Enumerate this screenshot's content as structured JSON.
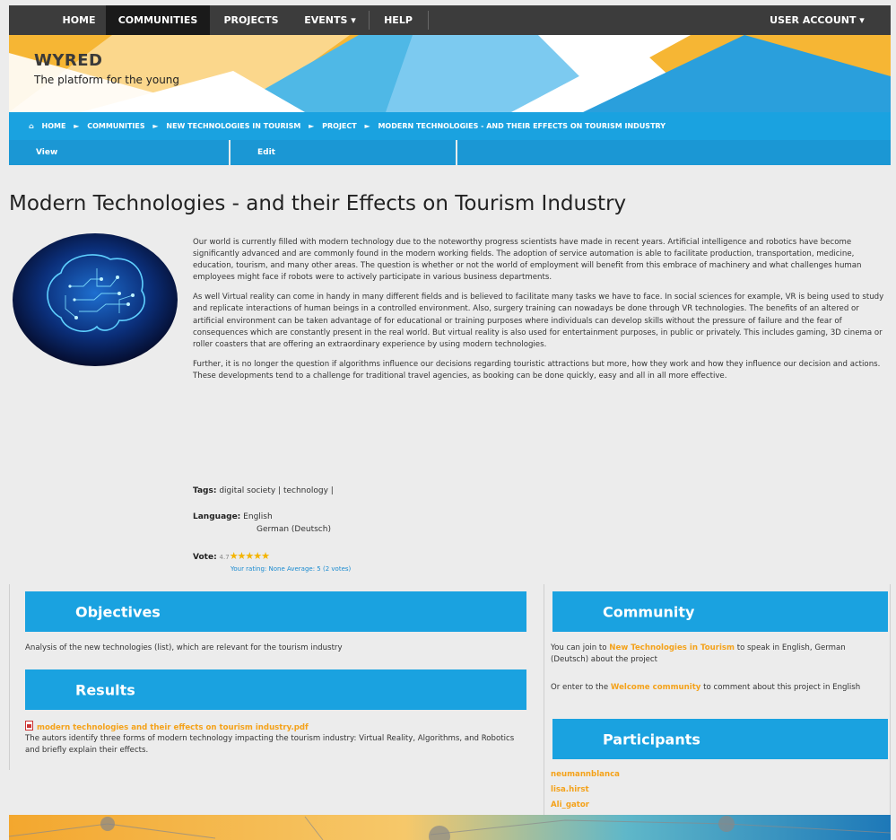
{
  "nav": {
    "items": [
      {
        "label": "HOME"
      },
      {
        "label": "COMMUNITIES"
      },
      {
        "label": "PROJECTS"
      },
      {
        "label": "EVENTS ▾"
      },
      {
        "label": "HELP"
      }
    ],
    "account": "USER ACCOUNT ▾"
  },
  "site": {
    "title": "WYRED",
    "subtitle": "The platform for the young"
  },
  "breadcrumb": [
    "HOME",
    "COMMUNITIES",
    "NEW TECHNOLOGIES IN TOURISM",
    "PROJECT",
    "MODERN TECHNOLOGIES - AND THEIR EFFECTS ON TOURISM INDUSTRY"
  ],
  "tabs": {
    "view": "View",
    "edit": "Edit"
  },
  "project": {
    "title": "Modern Technologies - and their Effects on Tourism Industry",
    "paragraphs": [
      "Our world is currently filled with modern technology due to the noteworthy progress scientists have made in recent years. Artificial intelligence and robotics have become significantly advanced and are commonly found in the modern working fields. The adoption of service automation is able to facilitate production, transportation, medicine, education, tourism, and many other areas. The question is whether or not the world of employment will benefit from this embrace of machinery and what challenges human employees might face if robots were to actively participate in various business departments.",
      "As well Virtual reality can come in handy in many different fields and is believed to facilitate many tasks we have to face. In social sciences for example, VR is being used to study and replicate interactions of human beings in a controlled environment. Also, surgery training can nowadays be done through VR technologies. The benefits of an altered or artificial environment can be taken advantage of for educational or training purposes where individuals can develop skills without the pressure of failure and the fear of consequences which are constantly present in the real world. But virtual reality is also used for entertainment purposes, in public or privately. This includes gaming, 3D cinema or roller coasters that are offering an extraordinary experience by using modern technologies.",
      "Further, it is no longer the question if algorithms influence our decisions regarding touristic attractions but more, how they work and how they influence our  decision and actions. These developments tend to a challenge for traditional travel agencies, as booking can be done quickly, easy and all in all more effective."
    ],
    "tags_label": "Tags:",
    "tags": "digital society | technology |",
    "language_label": "Language:",
    "languages": [
      "English",
      "German (Deutsch)"
    ],
    "vote_label": "Vote:",
    "vote_prefix": "4.7",
    "stars": "★★★★★",
    "rating_text": "Your rating: None Average: 5 (2 votes)"
  },
  "objectives": {
    "heading": "Objectives",
    "text": "Analysis of the new technologies (list), which are relevant for the tourism industry"
  },
  "results": {
    "heading": "Results",
    "file": "modern technologies and their effects on tourism industry.pdf",
    "text": "The autors identify three forms of modern technology impacting the tourism industry: Virtual Reality, Algorithms, and Robotics and briefly explain their effects."
  },
  "community": {
    "heading": "Community",
    "join_prefix": "You can join to ",
    "join_link": "New Technologies in Tourism",
    "join_suffix": " to speak in English, German (Deutsch) about the project",
    "enter_prefix": "Or enter to the ",
    "enter_link": "Welcome community",
    "enter_suffix": " to comment about this project in English"
  },
  "participants": {
    "heading": "Participants",
    "names": [
      "neumannblanca",
      "lisa.hirst",
      "Ali_gator"
    ]
  }
}
